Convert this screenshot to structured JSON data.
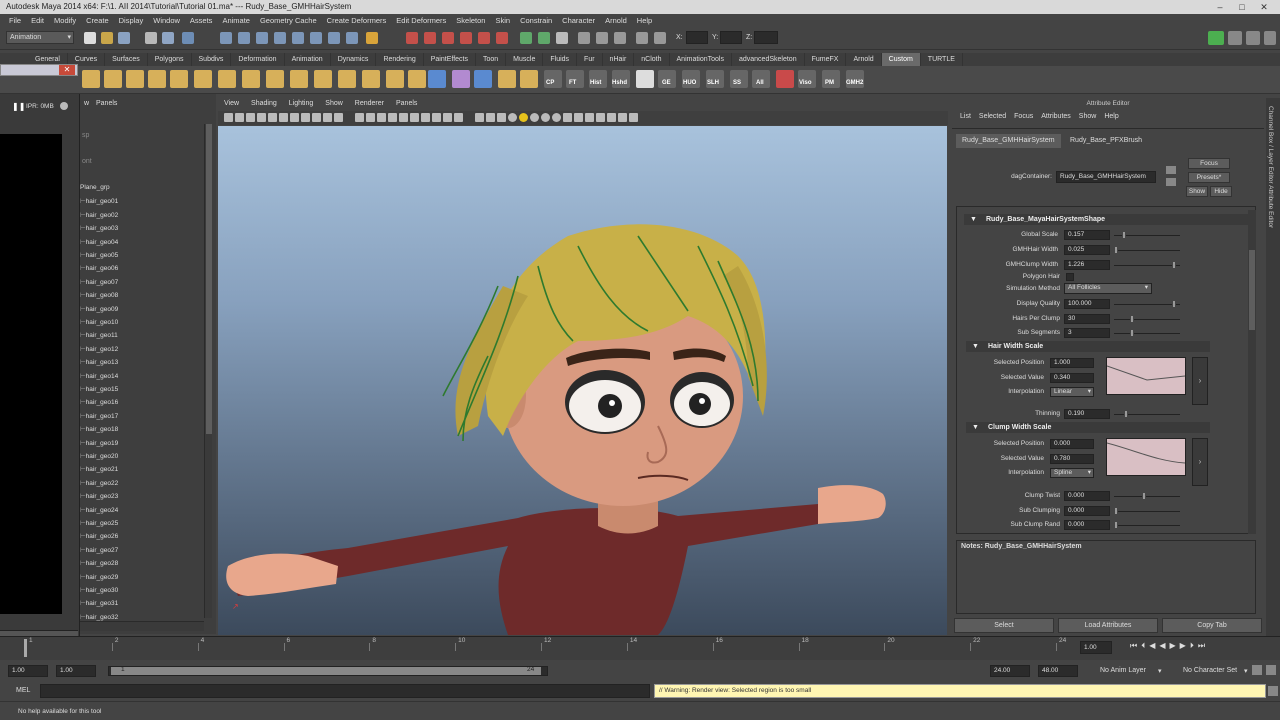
{
  "title_bar": {
    "text": "Autodesk Maya 2014 x64: F:\\1. AII 2014\\Tutorial\\Tutorial 01.ma*   ---   Rudy_Base_GMHHairSystem"
  },
  "menus": [
    "File",
    "Edit",
    "Modify",
    "Create",
    "Display",
    "Window",
    "Assets",
    "Animate",
    "Geometry Cache",
    "Create Deformers",
    "Edit Deformers",
    "Skeleton",
    "Skin",
    "Constrain",
    "Character",
    "Arnold",
    "Help"
  ],
  "status_line": {
    "mode": "Animation",
    "x_label": "X:",
    "y_label": "Y:",
    "z_label": "Z:"
  },
  "shelf_tabs": [
    "General",
    "Curves",
    "Surfaces",
    "Polygons",
    "Subdivs",
    "Deformation",
    "Animation",
    "Dynamics",
    "Rendering",
    "PaintEffects",
    "Toon",
    "Muscle",
    "Fluids",
    "Fur",
    "nHair",
    "nCloth",
    "AnimationTools",
    "advancedSkeleton",
    "FumeFX",
    "Arnold",
    "Custom",
    "TURTLE"
  ],
  "shelf_active": "Custom",
  "shelf_labels": [
    "CP",
    "FT",
    "Hist",
    "Hshd",
    "GE",
    "HUO",
    "SLH",
    "SS",
    "All",
    "Viso",
    "PM",
    "GMH2"
  ],
  "ipr": {
    "label": "IPR: 0MB"
  },
  "outliner": {
    "menu_label": "Panels",
    "frag_persp": "sp",
    "frag_front": "ont",
    "items": [
      "Plane_grp",
      "hair_geo01",
      "hair_geo02",
      "hair_geo03",
      "hair_geo04",
      "hair_geo05",
      "hair_geo06",
      "hair_geo07",
      "hair_geo08",
      "hair_geo09",
      "hair_geo10",
      "hair_geo11",
      "hair_geo12",
      "hair_geo13",
      "hair_geo14",
      "hair_geo15",
      "hair_geo16",
      "hair_geo17",
      "hair_geo18",
      "hair_geo19",
      "hair_geo20",
      "hair_geo21",
      "hair_geo22",
      "hair_geo23",
      "hair_geo24",
      "hair_geo25",
      "hair_geo26",
      "hair_geo27",
      "hair_geo28",
      "hair_geo29",
      "hair_geo30",
      "hair_geo31",
      "hair_geo32"
    ]
  },
  "viewport_menu": [
    "View",
    "Shading",
    "Lighting",
    "Show",
    "Renderer",
    "Panels"
  ],
  "attribute_editor": {
    "title": "Attribute Editor",
    "menu": [
      "List",
      "Selected",
      "Focus",
      "Attributes",
      "Show",
      "Help"
    ],
    "tabs": [
      "Rudy_Base_GMHHairSystem",
      "Rudy_Base_PFXBrush"
    ],
    "buttons": {
      "focus": "Focus",
      "presets": "Presets*",
      "show": "Show",
      "hide": "Hide"
    },
    "dag_label": "dagContainer:",
    "dag_value": "Rudy_Base_GMHHairSystem",
    "section_main": "Rudy_Base_MayaHairSystemShape",
    "attrs": [
      {
        "label": "Global Scale",
        "value": "0.157"
      },
      {
        "label": "GMHHair Width",
        "value": "0.025"
      },
      {
        "label": "GMHClump Width",
        "value": "1.226"
      }
    ],
    "polygon_hair": "Polygon Hair",
    "sim_label": "Simulation Method",
    "sim_value": "All Follicles",
    "display_quality": {
      "label": "Display Quality",
      "value": "100.000"
    },
    "hairs_per_clump": {
      "label": "Hairs Per Clump",
      "value": "30"
    },
    "sub_segments": {
      "label": "Sub Segments",
      "value": "3"
    },
    "hair_width_scale": {
      "title": "Hair Width Scale",
      "pos_label": "Selected Position",
      "pos_value": "1.000",
      "val_label": "Selected Value",
      "val_value": "0.340",
      "interp_label": "Interpolation",
      "interp_value": "Linear"
    },
    "thinning": {
      "label": "Thinning",
      "value": "0.190"
    },
    "clump_width_scale": {
      "title": "Clump Width Scale",
      "pos_label": "Selected Position",
      "pos_value": "0.000",
      "val_label": "Selected Value",
      "val_value": "0.780",
      "interp_label": "Interpolation",
      "interp_value": "Spline"
    },
    "clump_twist": {
      "label": "Clump Twist",
      "value": "0.000"
    },
    "sub_clumping": {
      "label": "Sub Clumping",
      "value": "0.000"
    },
    "sub_clump_rand": {
      "label": "Sub Clump Rand",
      "value": "0.000"
    },
    "notes": "Notes:  Rudy_Base_GMHHairSystem",
    "bottom_buttons": [
      "Select",
      "Load Attributes",
      "Copy Tab"
    ],
    "side_tabs": "Channel Box / Layer Editor    Attribute Editor"
  },
  "time_slider": {
    "ticks": [
      "1",
      "2",
      "4",
      "6",
      "8",
      "10",
      "12",
      "14",
      "16",
      "18",
      "20",
      "22",
      "24"
    ],
    "current": "1.00"
  },
  "range_slider": {
    "start": "1.00",
    "start_inner": "1.00",
    "range_start": "1",
    "range_end": "24",
    "end_inner": "24.00",
    "end": "48.00",
    "anim_layer": "No Anim Layer",
    "character_set": "No Character Set"
  },
  "command_line": {
    "label": "MEL",
    "result": "// Warning: Render view: Selected region is too small"
  },
  "help_line": "No help available for this tool",
  "colors": {
    "accent": "#6a6a6a",
    "warning": "#fff6b3",
    "viewport_top": "#a8c2dc",
    "viewport_bottom": "#3c4a5c"
  }
}
